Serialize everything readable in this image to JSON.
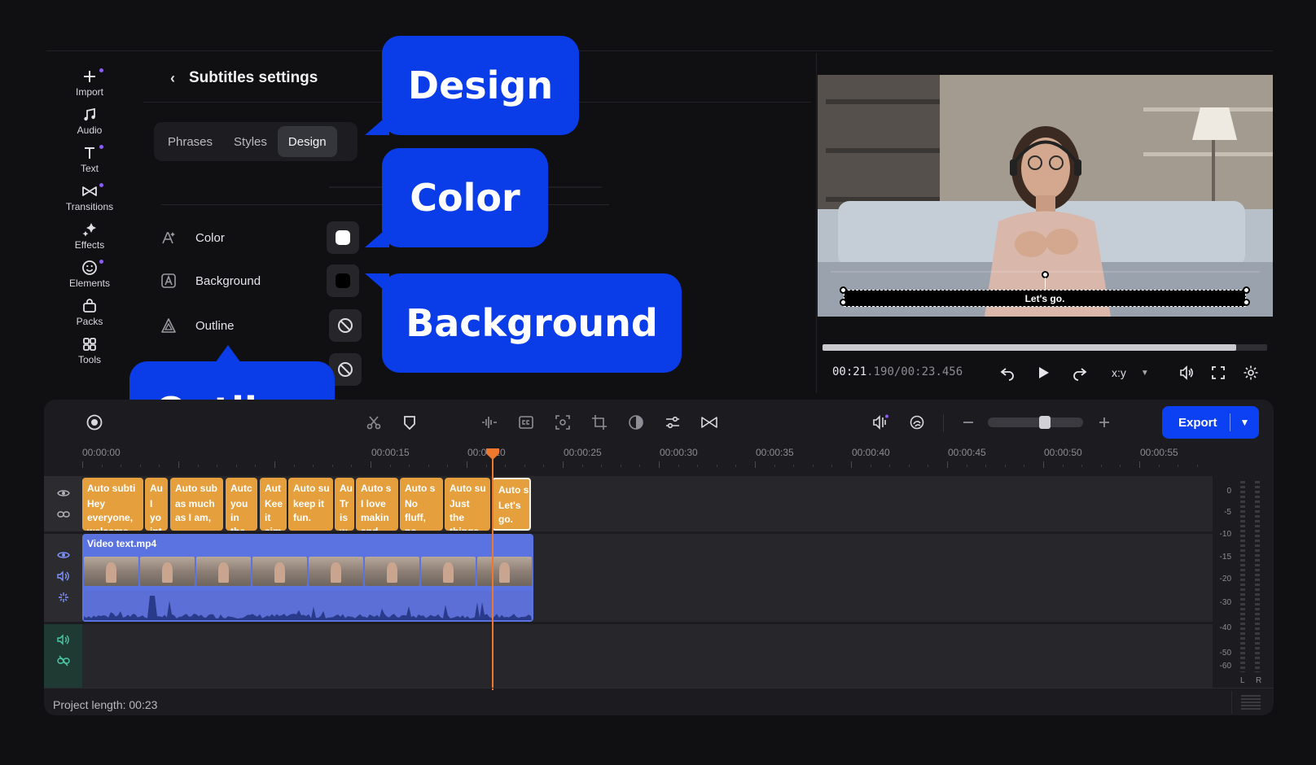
{
  "nav": {
    "items": [
      {
        "label": "Import",
        "icon": "plus-icon",
        "dot": true
      },
      {
        "label": "Audio",
        "icon": "music-note-icon",
        "dot": false
      },
      {
        "label": "Text",
        "icon": "text-icon",
        "dot": true
      },
      {
        "label": "Transitions",
        "icon": "bowtie-transition-icon",
        "dot": true
      },
      {
        "label": "Effects",
        "icon": "sparkle-icon",
        "dot": false
      },
      {
        "label": "Elements",
        "icon": "smiley-icon",
        "dot": true
      },
      {
        "label": "Packs",
        "icon": "bag-icon",
        "dot": false
      },
      {
        "label": "Tools",
        "icon": "grid-tools-icon",
        "dot": false
      }
    ]
  },
  "panel": {
    "title": "Subtitles settings",
    "tabs": [
      "Phrases",
      "Styles",
      "Design"
    ],
    "active_tab": "Design",
    "properties": [
      {
        "label": "Color",
        "icon": "font-color-icon"
      },
      {
        "label": "Background",
        "icon": "background-icon"
      },
      {
        "label": "Outline",
        "icon": "outline-icon"
      }
    ]
  },
  "callouts": {
    "design": "Design",
    "color": "Color",
    "background": "Background",
    "outline": "Outline"
  },
  "preview": {
    "subtitle_text": "Let's go.",
    "timecode_current": "00:21",
    "timecode_current_ms": ".190",
    "timecode_total": "/00:23.456",
    "progress_fraction": 0.93,
    "aspect_ratio": "x:y"
  },
  "toolbar": {
    "export_label": "Export",
    "zoom_fraction": 0.6
  },
  "ruler": {
    "labels": [
      "00:00:00",
      "00:00:15",
      "00:00:20",
      "00:00:25",
      "00:00:30",
      "00:00:35",
      "00:00:40",
      "00:00:45",
      "00:00:50",
      "00:00:55"
    ]
  },
  "subtitle_clips": [
    {
      "title": "Auto subti",
      "body": "Hey\neveryone,\nwelcome"
    },
    {
      "title": "Au",
      "body": "I\nyo\nint"
    },
    {
      "title": "Auto sub",
      "body": "as much\nas I am,"
    },
    {
      "title": "Autc",
      "body": "you\nin\nthe"
    },
    {
      "title": "Aut",
      "body": "Kee\nit\nsim"
    },
    {
      "title": "Auto su",
      "body": "keep it\nfun."
    },
    {
      "title": "Au",
      "body": "Tr\nis\nw"
    },
    {
      "title": "Auto s",
      "body": "I love\nmakin\nand"
    },
    {
      "title": "Auto s",
      "body": "No\nfluff,\nno"
    },
    {
      "title": "Auto su",
      "body": "Just\nthe\nthings"
    },
    {
      "title": "Auto s",
      "body": "Let's\ngo."
    }
  ],
  "video_clip": {
    "name": "Video text.mp4"
  },
  "meter": {
    "labels": [
      "0",
      "-5",
      "-10",
      "-15",
      "-20",
      "-30",
      "-40",
      "-50",
      "-60"
    ],
    "channels": [
      "L",
      "R"
    ]
  },
  "footer": {
    "project_length": "Project length: 00:23"
  },
  "colors": {
    "accent": "#0b41f2",
    "callout": "#0a3ce8",
    "subtitle_clip": "#e59f3c",
    "video_clip": "#5a73e0",
    "playhead": "#f0772e",
    "swatch_color": "#ffffff",
    "swatch_background": "#000000"
  }
}
